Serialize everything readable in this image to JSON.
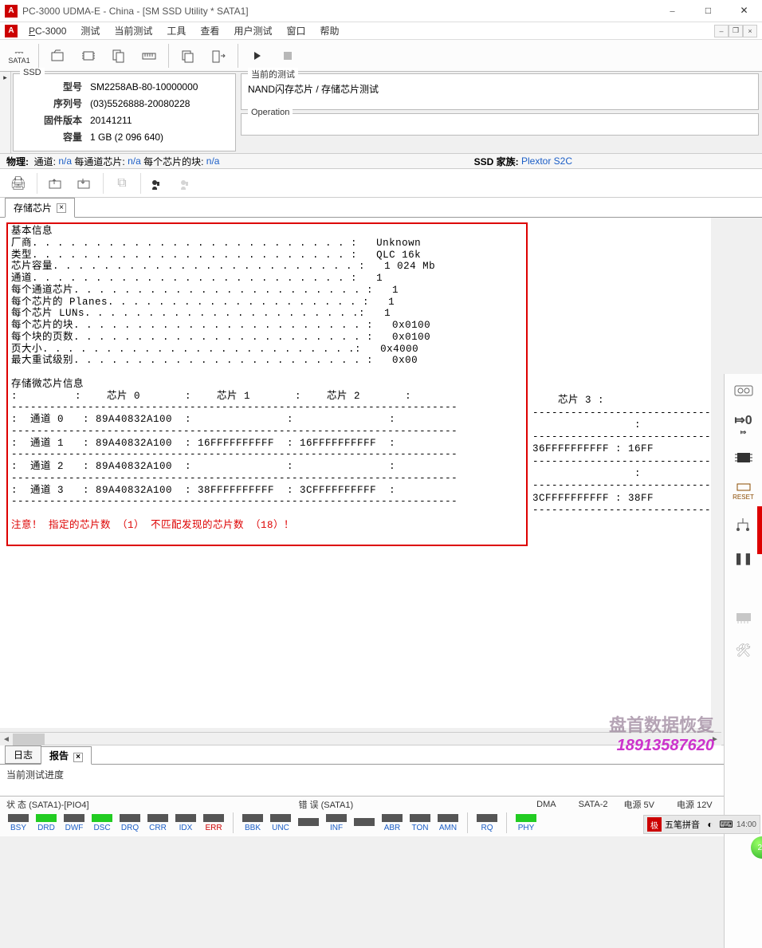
{
  "title": "PC-3000 UDMA-E - China - [SM SSD Utility * SATA1]",
  "menu": {
    "app": "PC-3000",
    "test": "测试",
    "cur": "当前测试",
    "tools": "工具",
    "view": "查看",
    "usertest": "用户测试",
    "window": "窗口",
    "help": "帮助"
  },
  "toolbar1_sata": "SATA1",
  "ssd": {
    "legend": "SSD",
    "model_l": "型号",
    "model_v": "SM2258AB-80-10000000",
    "serial_l": "序列号",
    "serial_v": "(03)5526888-20080228",
    "fw_l": "固件版本",
    "fw_v": "20141211",
    "cap_l": "容量",
    "cap_v": "1 GB (2 096 640)"
  },
  "curtest": {
    "legend": "当前的测试",
    "value": "NAND闪存芯片 / 存储芯片测试"
  },
  "operation": {
    "legend": "Operation"
  },
  "phys": {
    "label": "物理:",
    "ch": "通道:",
    "ch_v": "n/a",
    "pcc": "每通道芯片:",
    "pcc_v": "n/a",
    "blk": "每个芯片的块:",
    "blk_v": "n/a",
    "ssdfam_l": "SSD 家族:",
    "ssdfam_v": "Plextor S2C"
  },
  "tab_chip": "存储芯片",
  "report": {
    "h_basic": "基本信息",
    "r_vendor_l": "厂商",
    "r_vendor_v": "Unknown",
    "r_type_l": "类型",
    "r_type_v": "QLC 16k",
    "r_cap_l": "芯片容量",
    "r_cap_v": "1 024 Mb",
    "r_ch_l": "通道",
    "r_ch_v": "1",
    "r_cpc_l": "每个通道芯片",
    "r_cpc_v": "1",
    "r_planes_l": "每个芯片的 Planes",
    "r_planes_v": "1",
    "r_luns_l": "每个芯片 LUNs",
    "r_luns_v": "1",
    "r_blk_l": "每个芯片的块",
    "r_blk_v": "0x0100",
    "r_ppb_l": "每个块的页数",
    "r_ppb_v": "0x0100",
    "r_page_l": "页大小",
    "r_page_v": "0x4000",
    "r_retry_l": "最大重试级别",
    "r_retry_v": "0x00",
    "h_micro": "存储微芯片信息",
    "col0": "芯片 0",
    "col1": "芯片 1",
    "col2": "芯片 2",
    "col3": "芯片 3",
    "row0_l": "通道 0",
    "row0_c0": "89A40832A100",
    "row1_l": "通道 1",
    "row1_c0": "89A40832A100",
    "row1_c1": "16FFFFFFFFFF",
    "row1_c2": "16FFFFFFFFFF",
    "row1_c3a": "36FFFFFFFFFF",
    "row1_c3b": "16FF",
    "row2_l": "通道 2",
    "row2_c0": "89A40832A100",
    "row3_l": "通道 3",
    "row3_c0": "89A40832A100",
    "row3_c1": "38FFFFFFFFFF",
    "row3_c2": "3CFFFFFFFFFF",
    "row3_c3a": "3CFFFFFFFFFF",
    "row3_c3b": "38FF",
    "warn": "注意！ 指定的芯片数 （1） 不匹配发现的芯片数 （18）！"
  },
  "watermark": {
    "l1": "盘首数据恢复",
    "l2": "18913587620"
  },
  "btabs": {
    "log": "日志",
    "report": "报告"
  },
  "progress_l": "当前测试进度",
  "footer": {
    "state_l": "状 态 (SATA1)-[PIO4]",
    "err_l": "错 误 (SATA1)",
    "dma_l": "DMA",
    "sata2_l": "SATA-2",
    "p5_l": "电源 5V",
    "p12_l": "电源 12V",
    "leds": [
      "BSY",
      "DRD",
      "DWF",
      "DSC",
      "DRQ",
      "CRR",
      "IDX",
      "ERR"
    ],
    "errleds": [
      "BBK",
      "UNC",
      "",
      "INF",
      "",
      "ABR",
      "TON",
      "AMN"
    ],
    "rq": "RQ",
    "phy": "PHY"
  },
  "tray": {
    "ime": "五笔拼音",
    "time": "14:00"
  },
  "rtools": {
    "reset": "RESET"
  }
}
